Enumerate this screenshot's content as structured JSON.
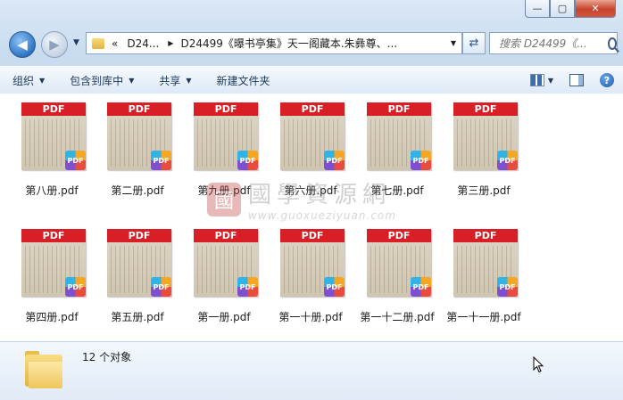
{
  "window": {
    "caption_buttons": {
      "minimize": "—",
      "maximize": "▢",
      "close": "✕"
    }
  },
  "nav": {
    "breadcrumb": [
      "«",
      "D24...",
      "D24499《曝书亭集》天一阁藏本.朱彝尊、..."
    ],
    "search_placeholder": "搜索 D24499《..."
  },
  "toolbar": {
    "organize": "组织",
    "include_in_library": "包含到库中",
    "share": "共享",
    "new_folder": "新建文件夹"
  },
  "files": [
    {
      "name": "第八册.pdf",
      "badge": "PDF",
      "band": "PDF"
    },
    {
      "name": "第二册.pdf",
      "badge": "PDF",
      "band": "PDF"
    },
    {
      "name": "第九册.pdf",
      "badge": "PDF",
      "band": "PDF"
    },
    {
      "name": "第六册.pdf",
      "badge": "PDF",
      "band": "PDF"
    },
    {
      "name": "第七册.pdf",
      "badge": "PDF",
      "band": "PDF"
    },
    {
      "name": "第三册.pdf",
      "badge": "PDF",
      "band": "PDF"
    },
    {
      "name": "第四册.pdf",
      "badge": "PDF",
      "band": "PDF"
    },
    {
      "name": "第五册.pdf",
      "badge": "PDF",
      "band": "PDF"
    },
    {
      "name": "第一册.pdf",
      "badge": "PDF",
      "band": "PDF"
    },
    {
      "name": "第一十册.pdf",
      "badge": "PDF",
      "band": "PDF"
    },
    {
      "name": "第一十二册.pdf",
      "badge": "PDF",
      "band": "PDF"
    },
    {
      "name": "第一十一册.pdf",
      "badge": "PDF",
      "band": "PDF"
    }
  ],
  "watermark": {
    "seal": "國",
    "title": "國學資源網",
    "url": "www.guoxueziyuan.com"
  },
  "status": {
    "count_text": "12 个对象"
  },
  "colors": {
    "pdf_band": "#d81f26",
    "toolbar_text": "#1e395b"
  }
}
